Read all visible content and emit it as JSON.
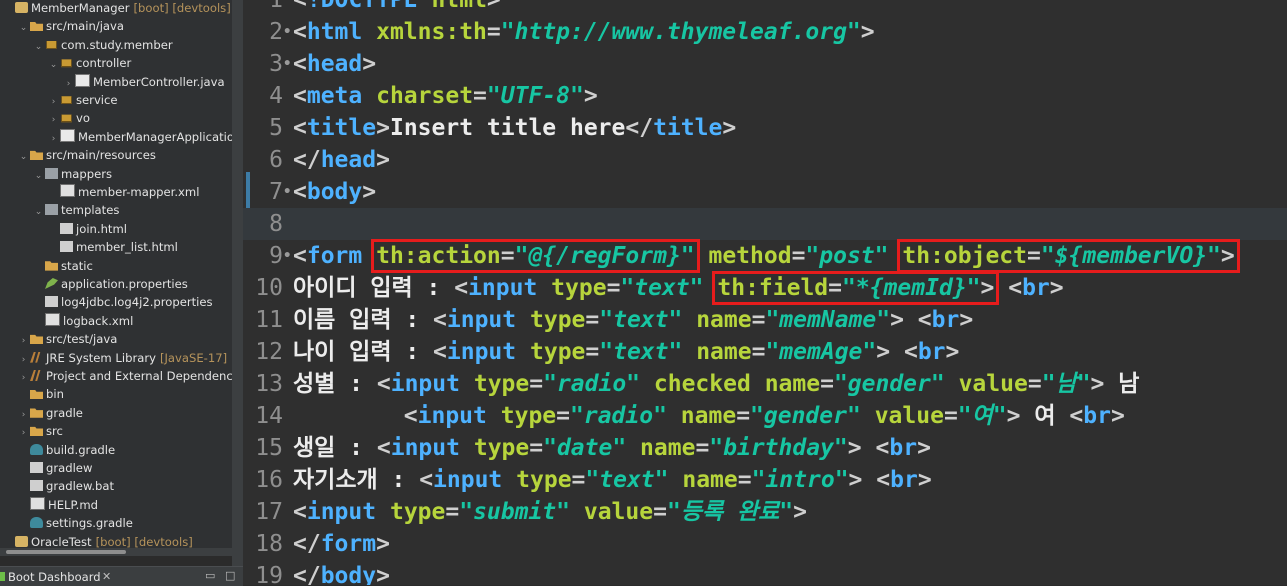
{
  "explorer": {
    "items": [
      {
        "arrow": "",
        "icon": "project",
        "label": "MemberManager",
        "deco": "[boot] [devtools]",
        "indent": 0
      },
      {
        "arrow": "⌄",
        "icon": "folder",
        "label": "src/main/java",
        "deco": "",
        "indent": 1
      },
      {
        "arrow": "⌄",
        "icon": "pkg",
        "label": "com.study.member",
        "deco": "",
        "indent": 2
      },
      {
        "arrow": "⌄",
        "icon": "pkg",
        "label": "controller",
        "deco": "",
        "indent": 3
      },
      {
        "arrow": "›",
        "icon": "java",
        "label": "MemberController.java",
        "deco": "",
        "indent": 4
      },
      {
        "arrow": "›",
        "icon": "pkg",
        "label": "service",
        "deco": "",
        "indent": 3
      },
      {
        "arrow": "›",
        "icon": "pkg",
        "label": "vo",
        "deco": "",
        "indent": 3
      },
      {
        "arrow": "›",
        "icon": "java",
        "label": "MemberManagerApplication",
        "deco": "",
        "indent": 3
      },
      {
        "arrow": "⌄",
        "icon": "folder",
        "label": "src/main/resources",
        "deco": "",
        "indent": 1
      },
      {
        "arrow": "⌄",
        "icon": "pkg-b",
        "label": "mappers",
        "deco": "",
        "indent": 2
      },
      {
        "arrow": "",
        "icon": "xml",
        "label": "member-mapper.xml",
        "deco": "",
        "indent": 3
      },
      {
        "arrow": "⌄",
        "icon": "pkg-b",
        "label": "templates",
        "deco": "",
        "indent": 2
      },
      {
        "arrow": "",
        "icon": "file",
        "label": "join.html",
        "deco": "",
        "indent": 3
      },
      {
        "arrow": "",
        "icon": "file",
        "label": "member_list.html",
        "deco": "",
        "indent": 3
      },
      {
        "arrow": "",
        "icon": "folder",
        "label": "static",
        "deco": "",
        "indent": 2
      },
      {
        "arrow": "",
        "icon": "props",
        "label": "application.properties",
        "deco": "",
        "indent": 2
      },
      {
        "arrow": "",
        "icon": "file",
        "label": "log4jdbc.log4j2.properties",
        "deco": "",
        "indent": 2
      },
      {
        "arrow": "",
        "icon": "xml",
        "label": "logback.xml",
        "deco": "",
        "indent": 2
      },
      {
        "arrow": "›",
        "icon": "folder",
        "label": "src/test/java",
        "deco": "",
        "indent": 1
      },
      {
        "arrow": "›",
        "icon": "lib",
        "label": "JRE System Library",
        "deco": "[JavaSE-17]",
        "indent": 1
      },
      {
        "arrow": "›",
        "icon": "lib",
        "label": "Project and External Dependencies",
        "deco": "",
        "indent": 1
      },
      {
        "arrow": "",
        "icon": "folder",
        "label": "bin",
        "deco": "",
        "indent": 1
      },
      {
        "arrow": "›",
        "icon": "folder",
        "label": "gradle",
        "deco": "",
        "indent": 1
      },
      {
        "arrow": "›",
        "icon": "folder",
        "label": "src",
        "deco": "",
        "indent": 1
      },
      {
        "arrow": "",
        "icon": "gradle",
        "label": "build.gradle",
        "deco": "",
        "indent": 1
      },
      {
        "arrow": "",
        "icon": "file",
        "label": "gradlew",
        "deco": "",
        "indent": 1
      },
      {
        "arrow": "",
        "icon": "file",
        "label": "gradlew.bat",
        "deco": "",
        "indent": 1
      },
      {
        "arrow": "",
        "icon": "xml",
        "label": "HELP.md",
        "deco": "",
        "indent": 1
      },
      {
        "arrow": "",
        "icon": "gradle",
        "label": "settings.gradle",
        "deco": "",
        "indent": 1
      },
      {
        "arrow": "",
        "icon": "project",
        "label": "OracleTest",
        "deco": "[boot] [devtools]",
        "indent": 0
      }
    ]
  },
  "boot_dashboard": {
    "label": "Boot Dashboard",
    "close": "✕",
    "minimize": "▭",
    "maximize": "□"
  },
  "editor": {
    "lines": [
      {
        "num": "1",
        "fold": "",
        "tokens": [
          [
            "c-punct",
            "<"
          ],
          [
            "c-tag",
            "!DOCTYPE"
          ],
          [
            "c-text",
            " "
          ],
          [
            "c-attr",
            "html"
          ],
          [
            "c-punct",
            ">"
          ]
        ]
      },
      {
        "num": "2",
        "fold": "•",
        "tokens": [
          [
            "c-punct",
            "<"
          ],
          [
            "c-tag",
            "html"
          ],
          [
            "c-text",
            " "
          ],
          [
            "c-attr",
            "xmlns:th"
          ],
          [
            "c-punct",
            "="
          ],
          [
            "c-val",
            "\"http://www.thymeleaf.org\""
          ],
          [
            "c-punct",
            ">"
          ]
        ]
      },
      {
        "num": "3",
        "fold": "•",
        "tokens": [
          [
            "c-punct",
            "<"
          ],
          [
            "c-tag",
            "head"
          ],
          [
            "c-punct",
            ">"
          ]
        ]
      },
      {
        "num": "4",
        "fold": "",
        "tokens": [
          [
            "c-punct",
            "<"
          ],
          [
            "c-tag",
            "meta"
          ],
          [
            "c-text",
            " "
          ],
          [
            "c-attr",
            "charset"
          ],
          [
            "c-punct",
            "="
          ],
          [
            "c-val",
            "\"UTF-8\""
          ],
          [
            "c-punct",
            ">"
          ]
        ]
      },
      {
        "num": "5",
        "fold": "",
        "tokens": [
          [
            "c-punct",
            "<"
          ],
          [
            "c-tag",
            "title"
          ],
          [
            "c-punct",
            ">"
          ],
          [
            "c-text",
            "Insert title here"
          ],
          [
            "c-punct",
            "</"
          ],
          [
            "c-tag",
            "title"
          ],
          [
            "c-punct",
            ">"
          ]
        ]
      },
      {
        "num": "6",
        "fold": "",
        "tokens": [
          [
            "c-punct",
            "</"
          ],
          [
            "c-tag",
            "head"
          ],
          [
            "c-punct",
            ">"
          ]
        ]
      },
      {
        "num": "7",
        "fold": "•",
        "tokens": [
          [
            "c-punct",
            "<"
          ],
          [
            "c-tag",
            "body"
          ],
          [
            "c-punct",
            ">"
          ]
        ]
      },
      {
        "num": "8",
        "fold": "",
        "current": true,
        "tokens": []
      },
      {
        "num": "9",
        "fold": "•",
        "tokens": [
          [
            "c-punct",
            "<"
          ],
          [
            "c-tag",
            "form"
          ],
          [
            "c-text",
            " "
          ],
          [
            "c-attr",
            "th:action"
          ],
          [
            "c-punct",
            "="
          ],
          [
            "c-val",
            "\"@{/regForm}\""
          ],
          [
            "c-text",
            " "
          ],
          [
            "c-attr",
            "method"
          ],
          [
            "c-punct",
            "="
          ],
          [
            "c-val",
            "\"post\""
          ],
          [
            "c-text",
            " "
          ],
          [
            "c-attr",
            "th:object"
          ],
          [
            "c-punct",
            "="
          ],
          [
            "c-val",
            "\"${memberVO}\""
          ],
          [
            "c-punct",
            ">"
          ]
        ]
      },
      {
        "num": "10",
        "fold": "",
        "tokens": [
          [
            "c-text",
            "아이디 입력 : "
          ],
          [
            "c-punct",
            "<"
          ],
          [
            "c-tag",
            "input"
          ],
          [
            "c-text",
            " "
          ],
          [
            "c-attr",
            "type"
          ],
          [
            "c-punct",
            "="
          ],
          [
            "c-val",
            "\"text\""
          ],
          [
            "c-text",
            " "
          ],
          [
            "c-attr",
            "th:field"
          ],
          [
            "c-punct",
            "="
          ],
          [
            "c-val",
            "\"*{memId}\""
          ],
          [
            "c-punct",
            ">"
          ],
          [
            "c-text",
            " "
          ],
          [
            "c-punct",
            "<"
          ],
          [
            "c-tag",
            "br"
          ],
          [
            "c-punct",
            ">"
          ]
        ]
      },
      {
        "num": "11",
        "fold": "",
        "tokens": [
          [
            "c-text",
            "이름 입력 : "
          ],
          [
            "c-punct",
            "<"
          ],
          [
            "c-tag",
            "input"
          ],
          [
            "c-text",
            " "
          ],
          [
            "c-attr",
            "type"
          ],
          [
            "c-punct",
            "="
          ],
          [
            "c-val",
            "\"text\""
          ],
          [
            "c-text",
            " "
          ],
          [
            "c-attr",
            "name"
          ],
          [
            "c-punct",
            "="
          ],
          [
            "c-val",
            "\"memName\""
          ],
          [
            "c-punct",
            ">"
          ],
          [
            "c-text",
            " "
          ],
          [
            "c-punct",
            "<"
          ],
          [
            "c-tag",
            "br"
          ],
          [
            "c-punct",
            ">"
          ]
        ]
      },
      {
        "num": "12",
        "fold": "",
        "tokens": [
          [
            "c-text",
            "나이 입력 : "
          ],
          [
            "c-punct",
            "<"
          ],
          [
            "c-tag",
            "input"
          ],
          [
            "c-text",
            " "
          ],
          [
            "c-attr",
            "type"
          ],
          [
            "c-punct",
            "="
          ],
          [
            "c-val",
            "\"text\""
          ],
          [
            "c-text",
            " "
          ],
          [
            "c-attr",
            "name"
          ],
          [
            "c-punct",
            "="
          ],
          [
            "c-val",
            "\"memAge\""
          ],
          [
            "c-punct",
            ">"
          ],
          [
            "c-text",
            " "
          ],
          [
            "c-punct",
            "<"
          ],
          [
            "c-tag",
            "br"
          ],
          [
            "c-punct",
            ">"
          ]
        ]
      },
      {
        "num": "13",
        "fold": "",
        "tokens": [
          [
            "c-text",
            "성별 : "
          ],
          [
            "c-punct",
            "<"
          ],
          [
            "c-tag",
            "input"
          ],
          [
            "c-text",
            " "
          ],
          [
            "c-attr",
            "type"
          ],
          [
            "c-punct",
            "="
          ],
          [
            "c-val",
            "\"radio\""
          ],
          [
            "c-text",
            " "
          ],
          [
            "c-attr",
            "checked"
          ],
          [
            "c-text",
            " "
          ],
          [
            "c-attr",
            "name"
          ],
          [
            "c-punct",
            "="
          ],
          [
            "c-val",
            "\"gender\""
          ],
          [
            "c-text",
            " "
          ],
          [
            "c-attr",
            "value"
          ],
          [
            "c-punct",
            "="
          ],
          [
            "c-val",
            "\"남\""
          ],
          [
            "c-punct",
            ">"
          ],
          [
            "c-text",
            " 남"
          ]
        ]
      },
      {
        "num": "14",
        "fold": "",
        "tokens": [
          [
            "c-text",
            "        "
          ],
          [
            "c-punct",
            "<"
          ],
          [
            "c-tag",
            "input"
          ],
          [
            "c-text",
            " "
          ],
          [
            "c-attr",
            "type"
          ],
          [
            "c-punct",
            "="
          ],
          [
            "c-val",
            "\"radio\""
          ],
          [
            "c-text",
            " "
          ],
          [
            "c-attr",
            "name"
          ],
          [
            "c-punct",
            "="
          ],
          [
            "c-val",
            "\"gender\""
          ],
          [
            "c-text",
            " "
          ],
          [
            "c-attr",
            "value"
          ],
          [
            "c-punct",
            "="
          ],
          [
            "c-val",
            "\"여\""
          ],
          [
            "c-punct",
            ">"
          ],
          [
            "c-text",
            " 여 "
          ],
          [
            "c-punct",
            "<"
          ],
          [
            "c-tag",
            "br"
          ],
          [
            "c-punct",
            ">"
          ]
        ]
      },
      {
        "num": "15",
        "fold": "",
        "tokens": [
          [
            "c-text",
            "생일 : "
          ],
          [
            "c-punct",
            "<"
          ],
          [
            "c-tag",
            "input"
          ],
          [
            "c-text",
            " "
          ],
          [
            "c-attr",
            "type"
          ],
          [
            "c-punct",
            "="
          ],
          [
            "c-val",
            "\"date\""
          ],
          [
            "c-text",
            " "
          ],
          [
            "c-attr",
            "name"
          ],
          [
            "c-punct",
            "="
          ],
          [
            "c-val",
            "\"birthday\""
          ],
          [
            "c-punct",
            ">"
          ],
          [
            "c-text",
            " "
          ],
          [
            "c-punct",
            "<"
          ],
          [
            "c-tag",
            "br"
          ],
          [
            "c-punct",
            ">"
          ]
        ]
      },
      {
        "num": "16",
        "fold": "",
        "tokens": [
          [
            "c-text",
            "자기소개 : "
          ],
          [
            "c-punct",
            "<"
          ],
          [
            "c-tag",
            "input"
          ],
          [
            "c-text",
            " "
          ],
          [
            "c-attr",
            "type"
          ],
          [
            "c-punct",
            "="
          ],
          [
            "c-val",
            "\"text\""
          ],
          [
            "c-text",
            " "
          ],
          [
            "c-attr",
            "name"
          ],
          [
            "c-punct",
            "="
          ],
          [
            "c-val",
            "\"intro\""
          ],
          [
            "c-punct",
            ">"
          ],
          [
            "c-text",
            " "
          ],
          [
            "c-punct",
            "<"
          ],
          [
            "c-tag",
            "br"
          ],
          [
            "c-punct",
            ">"
          ]
        ]
      },
      {
        "num": "17",
        "fold": "",
        "tokens": [
          [
            "c-punct",
            "<"
          ],
          [
            "c-tag",
            "input"
          ],
          [
            "c-text",
            " "
          ],
          [
            "c-attr",
            "type"
          ],
          [
            "c-punct",
            "="
          ],
          [
            "c-val",
            "\"submit\""
          ],
          [
            "c-text",
            " "
          ],
          [
            "c-attr",
            "value"
          ],
          [
            "c-punct",
            "="
          ],
          [
            "c-val",
            "\"등록 완료\""
          ],
          [
            "c-punct",
            ">"
          ]
        ]
      },
      {
        "num": "18",
        "fold": "",
        "tokens": [
          [
            "c-punct",
            "</"
          ],
          [
            "c-tag",
            "form"
          ],
          [
            "c-punct",
            ">"
          ]
        ]
      },
      {
        "num": "19",
        "fold": "",
        "tokens": [
          [
            "c-punct",
            "</"
          ],
          [
            "c-tag",
            "body"
          ],
          [
            "c-punct",
            ">"
          ]
        ]
      }
    ],
    "highlight_color": "#e61c1c"
  }
}
